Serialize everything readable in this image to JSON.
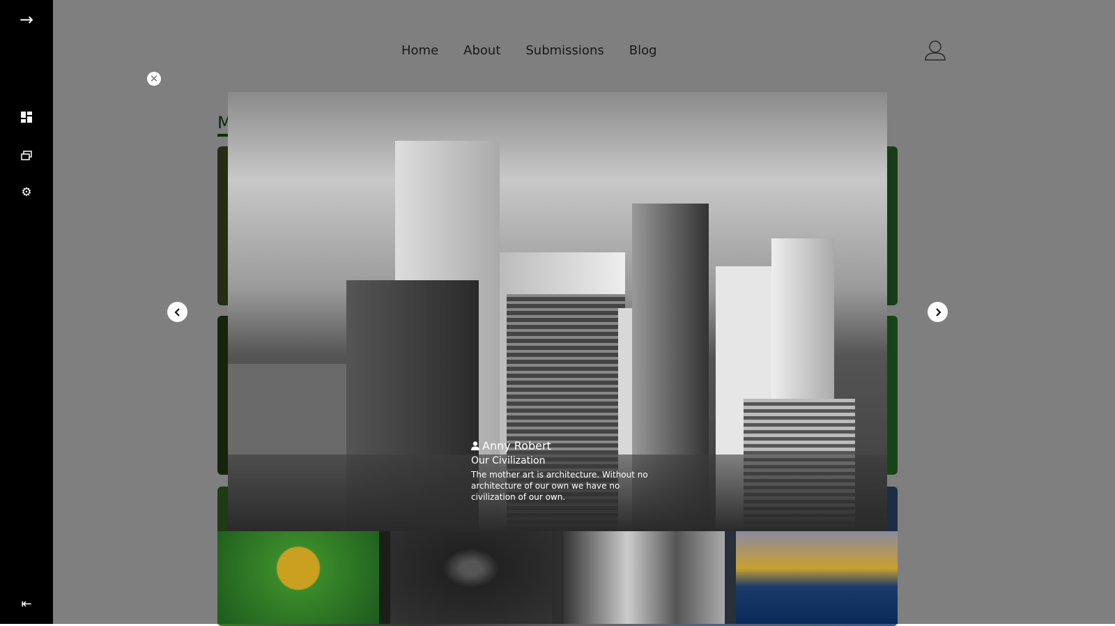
{
  "sidebar": {
    "items": [
      {
        "icon": "arrow-right-icon",
        "glyph": "→"
      },
      {
        "icon": "dashboard-icon"
      },
      {
        "icon": "gallery-icon"
      },
      {
        "icon": "gear-icon",
        "glyph": "⚙"
      },
      {
        "icon": "logout-icon",
        "glyph": "⇤"
      }
    ]
  },
  "nav": {
    "items": [
      "Home",
      "About",
      "Submissions",
      "Blog"
    ]
  },
  "section": {
    "title_partial": "M"
  },
  "lightbox": {
    "close_glyph": "✕",
    "prev_glyph": "‹",
    "next_glyph": "›",
    "author": "Anny Robert",
    "title": "Our Civilization",
    "description": "The mother art is architecture. Without no architecture of our own we have no civilization of our own."
  },
  "colors": {
    "sidebar": "#000000",
    "accent": "#1d5a1d",
    "overlay": "rgba(0,0,0,0.5)"
  }
}
